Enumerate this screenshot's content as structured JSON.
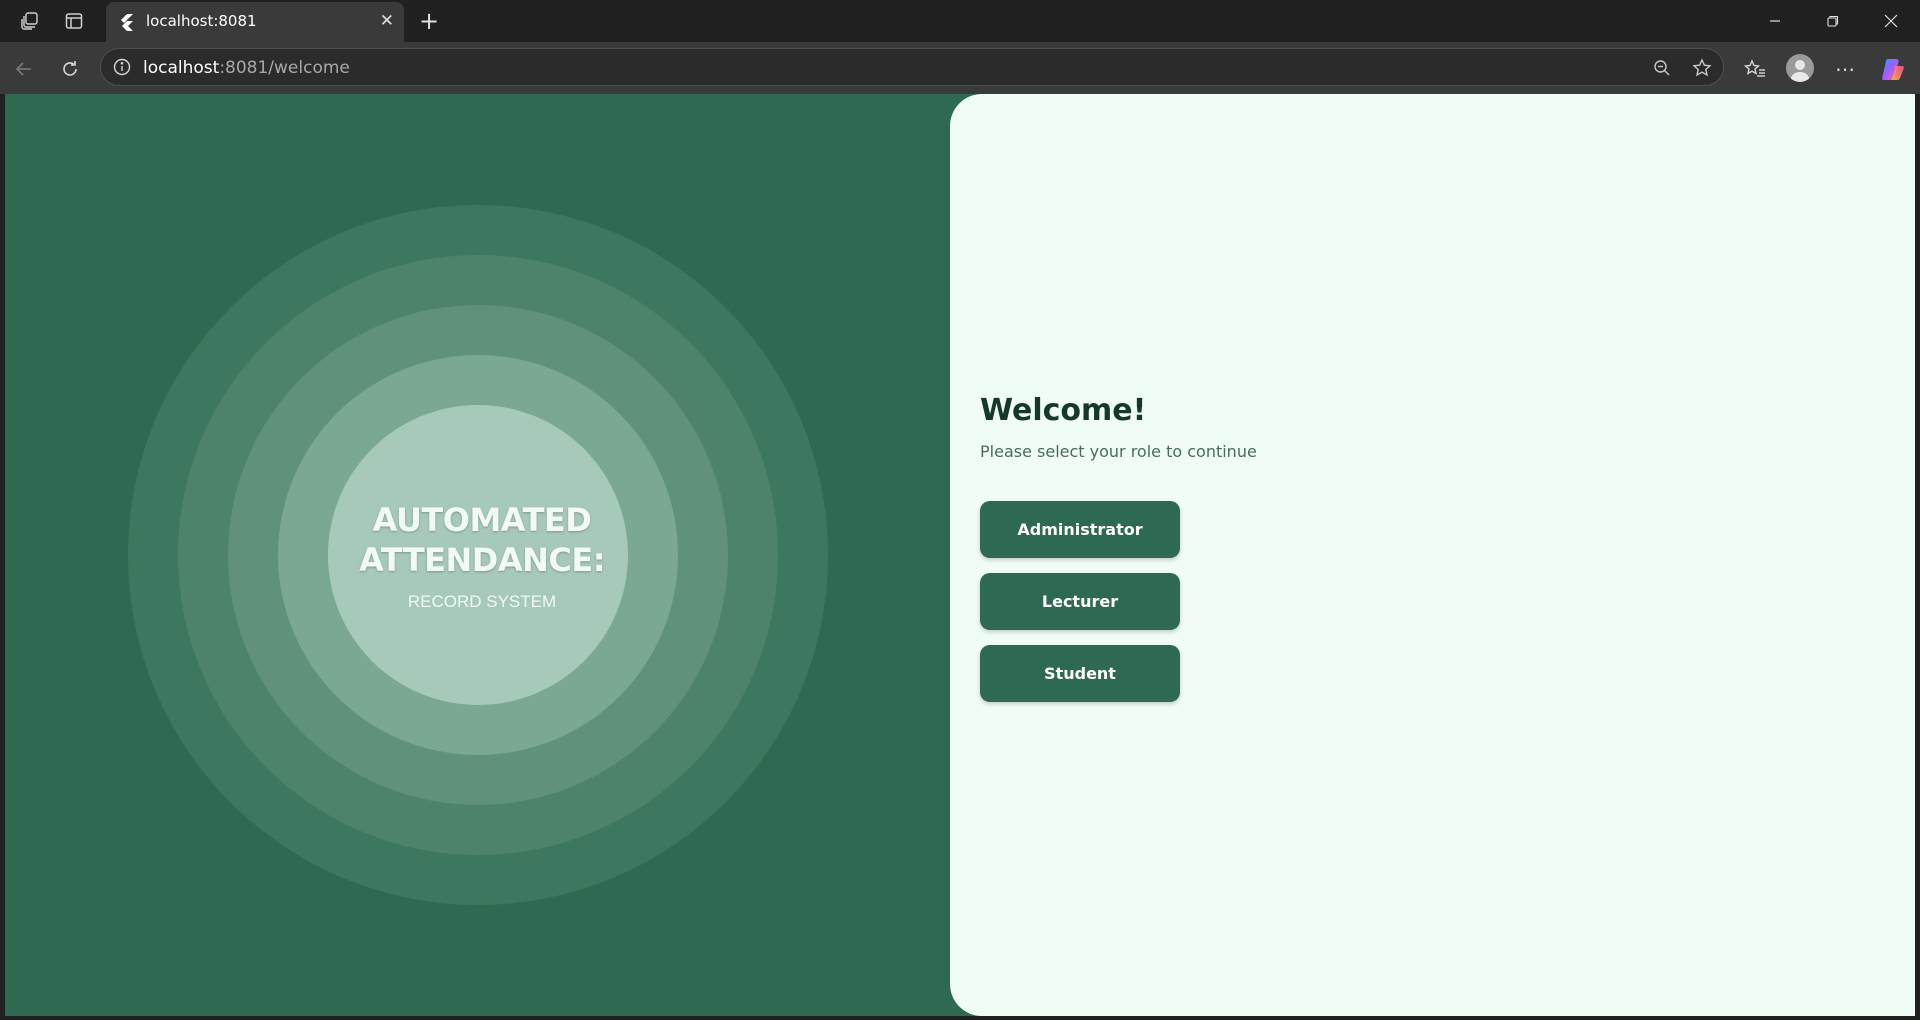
{
  "browser": {
    "tab_title": "localhost:8081",
    "url_host": "localhost",
    "url_path": ":8081/welcome",
    "icons": {
      "workspaces": "workspaces-icon",
      "tab_actions": "vertical-tabs-icon",
      "favicon": "flutter-logo-icon",
      "close_tab": "close-icon",
      "new_tab": "plus-icon",
      "minimize": "minimize-icon",
      "restore": "restore-icon",
      "close_window": "close-window-icon",
      "back": "back-arrow-icon",
      "refresh": "refresh-icon",
      "site_info": "info-icon",
      "zoom": "zoom-out-icon",
      "favorite": "star-icon",
      "favorites": "favorites-icon",
      "profile": "profile-icon",
      "more": "more-icon",
      "copilot": "copilot-icon"
    }
  },
  "hero": {
    "title_line1": "AUTOMATED",
    "title_line2": "ATTENDANCE:",
    "subtitle": "RECORD SYSTEM"
  },
  "welcome": {
    "heading": "Welcome!",
    "subtitle": "Please select your role to continue",
    "roles": [
      {
        "label": "Administrator"
      },
      {
        "label": "Lecturer"
      },
      {
        "label": "Student"
      }
    ]
  },
  "colors": {
    "primary": "#2e6a51",
    "panel_bg": "#effdf4",
    "heading": "#16382b",
    "muted": "#4d6a5d"
  }
}
